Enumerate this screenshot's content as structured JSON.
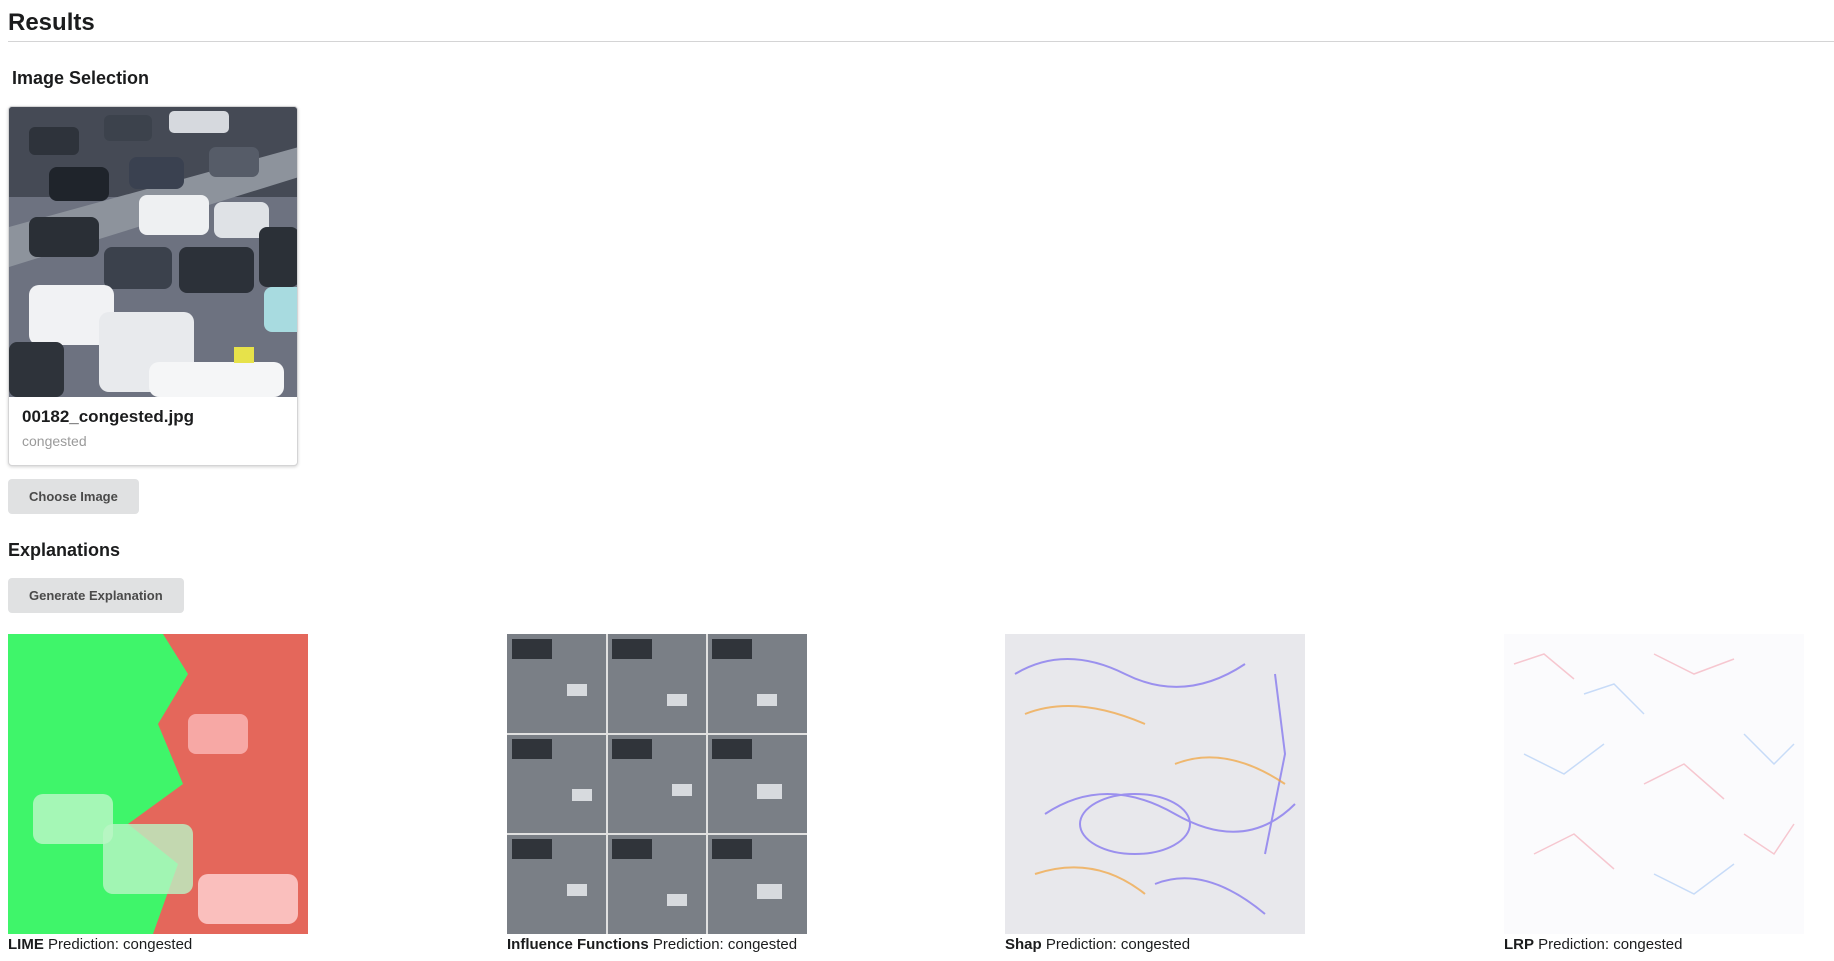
{
  "page": {
    "title": "Results"
  },
  "image_selection": {
    "title": "Image Selection",
    "selected_image": {
      "filename": "00182_congested.jpg",
      "label": "congested"
    },
    "choose_button": "Choose Image"
  },
  "explanations": {
    "title": "Explanations",
    "generate_button": "Generate Explanation",
    "items": [
      {
        "method": "LIME",
        "prediction": "Prediction: congested"
      },
      {
        "method": "Influence Functions",
        "prediction": "Prediction: congested"
      },
      {
        "method": "Shap",
        "prediction": "Prediction: congested"
      },
      {
        "method": "LRP",
        "prediction": "Prediction: congested"
      }
    ]
  }
}
